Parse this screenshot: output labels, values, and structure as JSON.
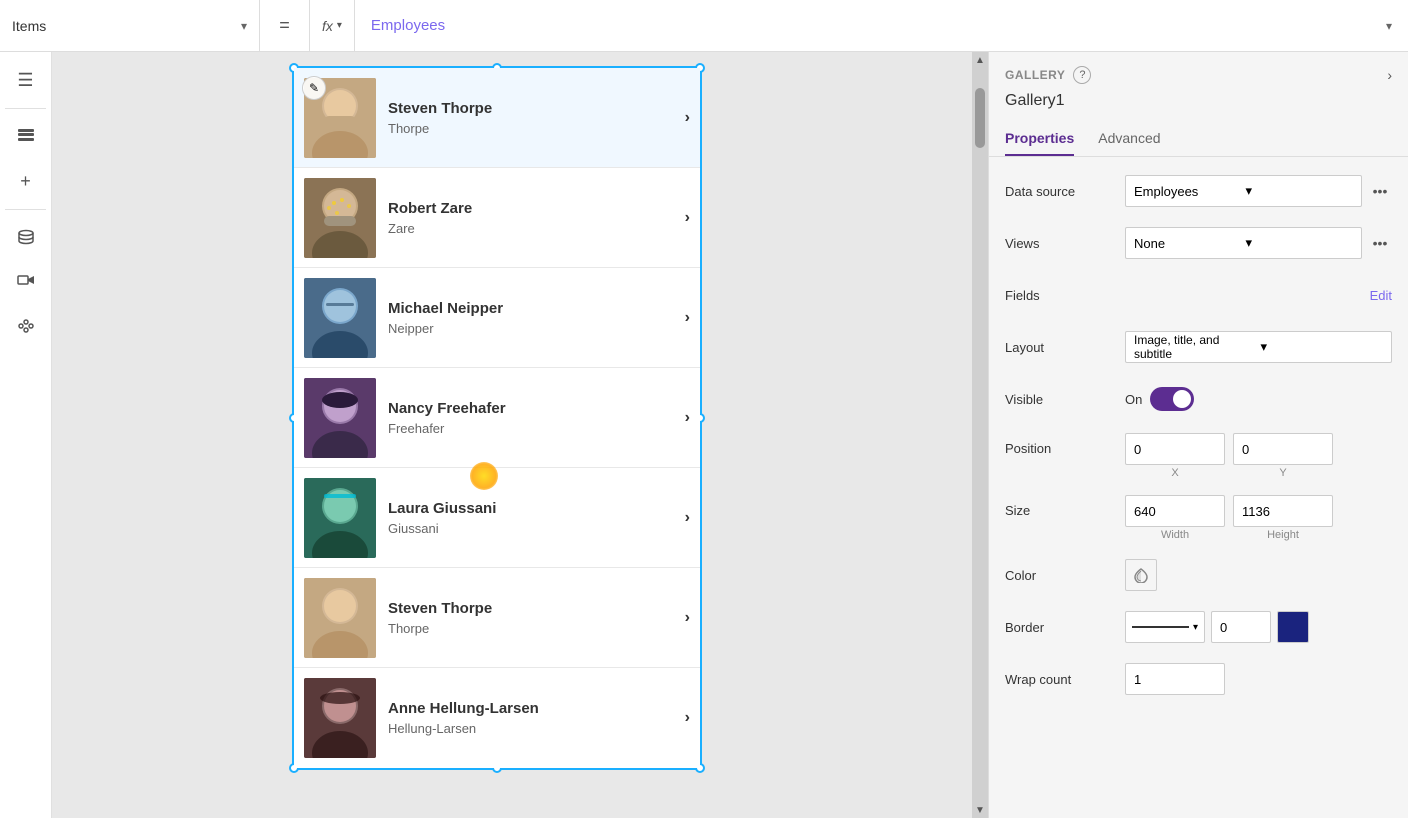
{
  "topbar": {
    "items_label": "Items",
    "items_chevron": "▾",
    "equals": "=",
    "fx_label": "fx",
    "fx_chevron": "▾",
    "formula_value": "Employees",
    "formula_end_chevron": "▾"
  },
  "sidebar": {
    "icons": [
      {
        "name": "hamburger-icon",
        "glyph": "☰"
      },
      {
        "name": "layers-icon",
        "glyph": "⊞"
      },
      {
        "name": "add-icon",
        "glyph": "+"
      },
      {
        "name": "database-icon",
        "glyph": "🗄"
      },
      {
        "name": "media-icon",
        "glyph": "▶"
      },
      {
        "name": "tools-icon",
        "glyph": "🔧"
      }
    ]
  },
  "gallery": {
    "items": [
      {
        "name": "Steven Thorpe",
        "subtitle": "Thorpe",
        "avatar_class": "av1",
        "selected": true
      },
      {
        "name": "Robert Zare",
        "subtitle": "Zare",
        "avatar_class": "av2",
        "selected": false
      },
      {
        "name": "Michael Neipper",
        "subtitle": "Neipper",
        "avatar_class": "av3",
        "selected": false
      },
      {
        "name": "Nancy Freehafer",
        "subtitle": "Freehafer",
        "avatar_class": "av4",
        "selected": false
      },
      {
        "name": "Laura Giussani",
        "subtitle": "Giussani",
        "avatar_class": "av5",
        "selected": false
      },
      {
        "name": "Steven Thorpe",
        "subtitle": "Thorpe",
        "avatar_class": "av6",
        "selected": false
      },
      {
        "name": "Anne Hellung-Larsen",
        "subtitle": "Hellung-Larsen",
        "avatar_class": "av7",
        "selected": false
      }
    ]
  },
  "right_panel": {
    "title": "GALLERY",
    "gallery_name": "Gallery1",
    "tab_properties": "Properties",
    "tab_advanced": "Advanced",
    "props": {
      "data_source_label": "Data source",
      "data_source_value": "Employees",
      "views_label": "Views",
      "views_value": "None",
      "fields_label": "Fields",
      "fields_edit": "Edit",
      "layout_label": "Layout",
      "layout_value": "Image, title, and subtitle",
      "visible_label": "Visible",
      "visible_toggle": "On",
      "position_label": "Position",
      "pos_x": "0",
      "pos_y": "0",
      "pos_x_label": "X",
      "pos_y_label": "Y",
      "size_label": "Size",
      "size_width": "640",
      "size_height": "1136",
      "size_w_label": "Width",
      "size_h_label": "Height",
      "color_label": "Color",
      "border_label": "Border",
      "border_value": "0",
      "wrap_count_label": "Wrap count",
      "wrap_count_value": "1"
    }
  }
}
